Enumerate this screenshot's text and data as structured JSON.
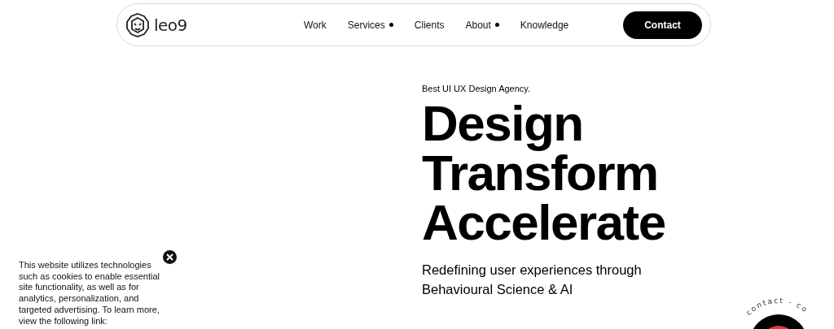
{
  "header": {
    "logo": "leo9",
    "nav": [
      {
        "label": "Work",
        "has_dropdown": false
      },
      {
        "label": "Services",
        "has_dropdown": true
      },
      {
        "label": "Clients",
        "has_dropdown": false
      },
      {
        "label": "About",
        "has_dropdown": true
      },
      {
        "label": "Knowledge",
        "has_dropdown": false
      }
    ],
    "cta": "Contact"
  },
  "hero": {
    "eyebrow": "Best UI UX Design Agency.",
    "headline": [
      "Design",
      "Transform",
      "Accelerate"
    ],
    "subtitle": [
      "Redefining user experiences through",
      "Behavioural Science & AI"
    ]
  },
  "cookie_notice": {
    "text": "This website utilizes technologies such as cookies to enable essential site functionality, as well as for analytics, personalization, and targeted advertising. To learn more, view the following link:"
  },
  "contact_badge": {
    "ring_text": "contact - co"
  }
}
